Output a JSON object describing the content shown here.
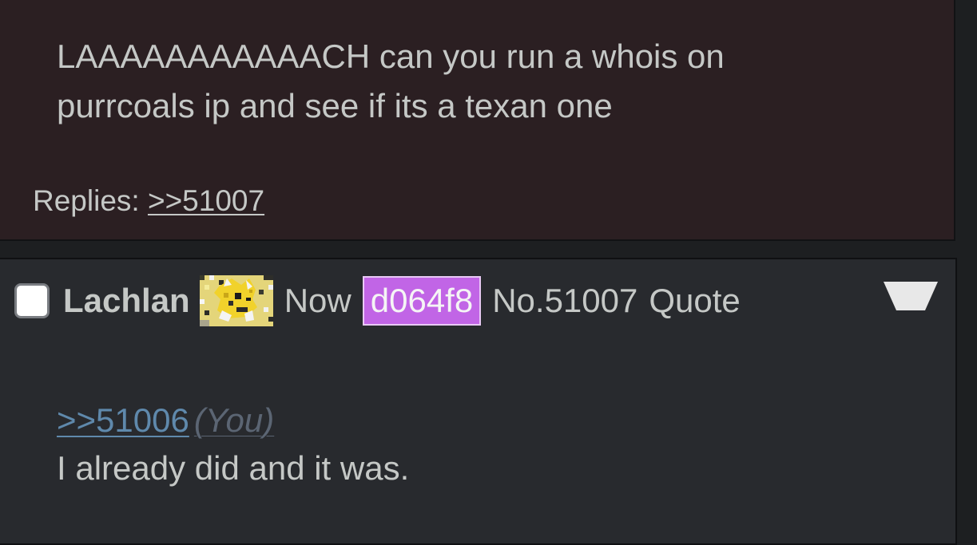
{
  "previous_post": {
    "message": "LAAAAAAAAAAACH can you run a whois on purrcoals ip and see if its a texan one",
    "replies_label": "Replies:",
    "replies_link": ">>51007"
  },
  "current_post": {
    "name": "Lachlan",
    "flag_icon": "pokemon-jolteon-flag-icon",
    "time": "Now",
    "poster_id": "d064f8",
    "post_number": "No.51007",
    "quote_label": "Quote",
    "quote_link": ">>51006",
    "you_marker": "(You)",
    "message": "I already did and it was."
  },
  "colors": {
    "previous_post_bg": "#2b1f22",
    "current_post_bg": "#282a2e",
    "id_badge_bg": "#c165e6",
    "quote_link": "#5f89ac",
    "text": "#c5c8c6"
  }
}
